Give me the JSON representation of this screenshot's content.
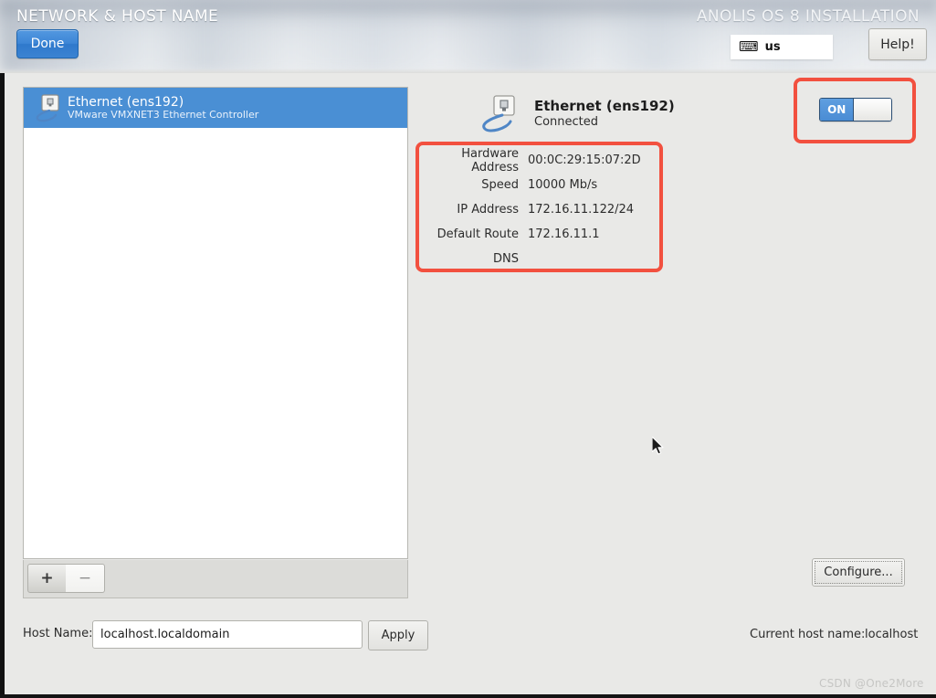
{
  "header": {
    "page_title": "NETWORK & HOST NAME",
    "product_title": "ANOLIS OS 8 INSTALLATION",
    "done_label": "Done",
    "help_label": "Help!",
    "keyboard_layout": "us",
    "keyboard_icon": "keyboard-icon"
  },
  "device_list": {
    "items": [
      {
        "name": "Ethernet (ens192)",
        "description": "VMware VMXNET3 Ethernet Controller",
        "icon": "ethernet-icon",
        "selected": true
      }
    ],
    "toolbar": {
      "add_label": "+",
      "remove_label": "−"
    }
  },
  "detail": {
    "icon": "ethernet-cable-icon",
    "title": "Ethernet (ens192)",
    "status": "Connected",
    "rows": [
      {
        "label": "Hardware Address",
        "value": "00:0C:29:15:07:2D"
      },
      {
        "label": "Speed",
        "value": "10000 Mb/s"
      },
      {
        "label": "IP Address",
        "value": "172.16.11.122/24"
      },
      {
        "label": "Default Route",
        "value": "172.16.11.1"
      },
      {
        "label": "DNS",
        "value": ""
      }
    ],
    "toggle": {
      "state_label": "ON",
      "on": true
    },
    "configure_label": "Configure..."
  },
  "hostname": {
    "label": "Host Name:",
    "value": "localhost.localdomain",
    "placeholder": "",
    "apply_label": "Apply",
    "current_label": "Current host name:",
    "current_value": "localhost"
  },
  "annotations": {
    "color": "#f2503f",
    "boxes": [
      "detail-table-highlight",
      "network-toggle-highlight"
    ]
  },
  "watermark": "CSDN @One2More"
}
